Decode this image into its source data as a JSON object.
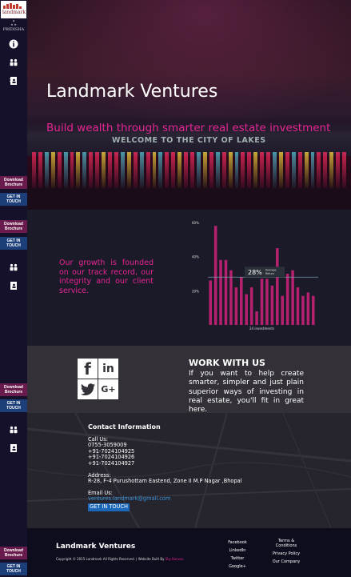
{
  "sidebar": {
    "logo_text": "landmark",
    "brand_name": "PRIDISHA",
    "download_label": "Download Brochure",
    "touch_label": "GET IN TOUCH"
  },
  "hero": {
    "title": "Landmark Ventures",
    "subtitle": "Build wealth through smarter real estate investment",
    "sign_text": "WELCOME TO THE CITY OF LAKES"
  },
  "growth": {
    "text": "Our growth is founded on our track record, our integrity and our client service."
  },
  "chart_data": {
    "type": "bar",
    "ylim": [
      0,
      60
    ],
    "ytick_labels": [
      "60%",
      "40%",
      "20%"
    ],
    "values": [
      26,
      58,
      38,
      38,
      32,
      22,
      28,
      18,
      22,
      8,
      27,
      27,
      23,
      45,
      17,
      30,
      32,
      22,
      17,
      19,
      17
    ],
    "xlabel": "24 investments",
    "callout": {
      "value": "28%",
      "label": "Average Return"
    },
    "average": 28,
    "bar_color": "#b5216f",
    "line_color": "#7da0b0"
  },
  "work": {
    "title": "WORK WITH US",
    "text": "If you want to help create smarter, simpler and just plain superior ways of investing in real estate, you'll fit in great here.",
    "tiles": [
      "f",
      "in",
      "t",
      "G+"
    ]
  },
  "contact": {
    "title": "Contact Information",
    "call_label": "Call Us:",
    "phones": [
      "0755-3059009",
      "+91-7024104925",
      "+91-7024104926",
      "+91-7024104927"
    ],
    "address_label": "Address:",
    "address": "R-28, F-4 Purushottam Eastend, Zone II M.P Nagar ,Bhopal",
    "email_label": "Email Us:",
    "email": "ventures.landmark@gmail.com",
    "button_label": "GET IN TOUCH"
  },
  "footer": {
    "title": "Landmark Ventures",
    "copyright": "Copyright © 2015 Landmark All Rights Reserved. | Website Built By",
    "builder": "Sky Kanvas",
    "links_col1": [
      "Facebook",
      "LinkedIn",
      "Twitter",
      "Google+"
    ],
    "links_col2": [
      "Terms & Conditions",
      "Privacy Policy",
      "Our Company"
    ]
  },
  "colors": {
    "accent_pink": "#e62592",
    "sidebar_bg": "#15112a",
    "download_bg": "#6a1b4d",
    "touch_bg": "#1c3f7a"
  }
}
